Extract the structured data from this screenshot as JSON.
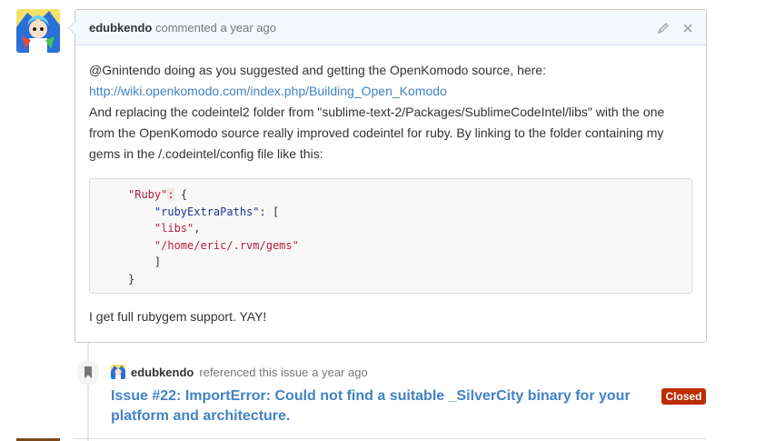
{
  "comment": {
    "author": "edubkendo",
    "action": "commented",
    "time": "a year ago",
    "line1": "@Gnintendo doing as you suggested and getting the OpenKomodo source, here:",
    "link": "http://wiki.openkomodo.com/index.php/Building_Open_Komodo",
    "line3": "And replacing the codeintel2 folder from \"sublime-text-2/Packages/SublimeCodeIntel/libs\" with the one",
    "line4": "from the OpenKomodo source really improved codeintel for ruby. By linking to the folder containing my",
    "line5": "gems in the /.codeintel/config file like this:",
    "code": {
      "l1_key": "\"Ruby\"",
      "l1_colon": ":",
      "l1_rest": " {",
      "l2_key": "\"rubyExtraPaths\"",
      "l2_rest": ": [",
      "l3_str": "\"libs\"",
      "l3_rest": ",",
      "l4_str": "\"/home/eric/.rvm/gems\"",
      "l5": "]",
      "l6": "}"
    },
    "final": "I get full rubygem support. YAY!"
  },
  "reference": {
    "author": "edubkendo",
    "text": "referenced this issue",
    "time": "a year ago",
    "issue_title": "Issue #22: ImportError: Could not find a suitable _SilverCity binary for your platform and architecture.",
    "status": "Closed"
  },
  "icons": {
    "edit": "pencil-icon",
    "delete": "close-icon",
    "reference": "bookmark-icon"
  },
  "colors": {
    "link": "#4183c4",
    "closed": "#bd2c00",
    "header_bg": "#f3f8fc",
    "string": "#b5203b",
    "key": "#183691"
  }
}
